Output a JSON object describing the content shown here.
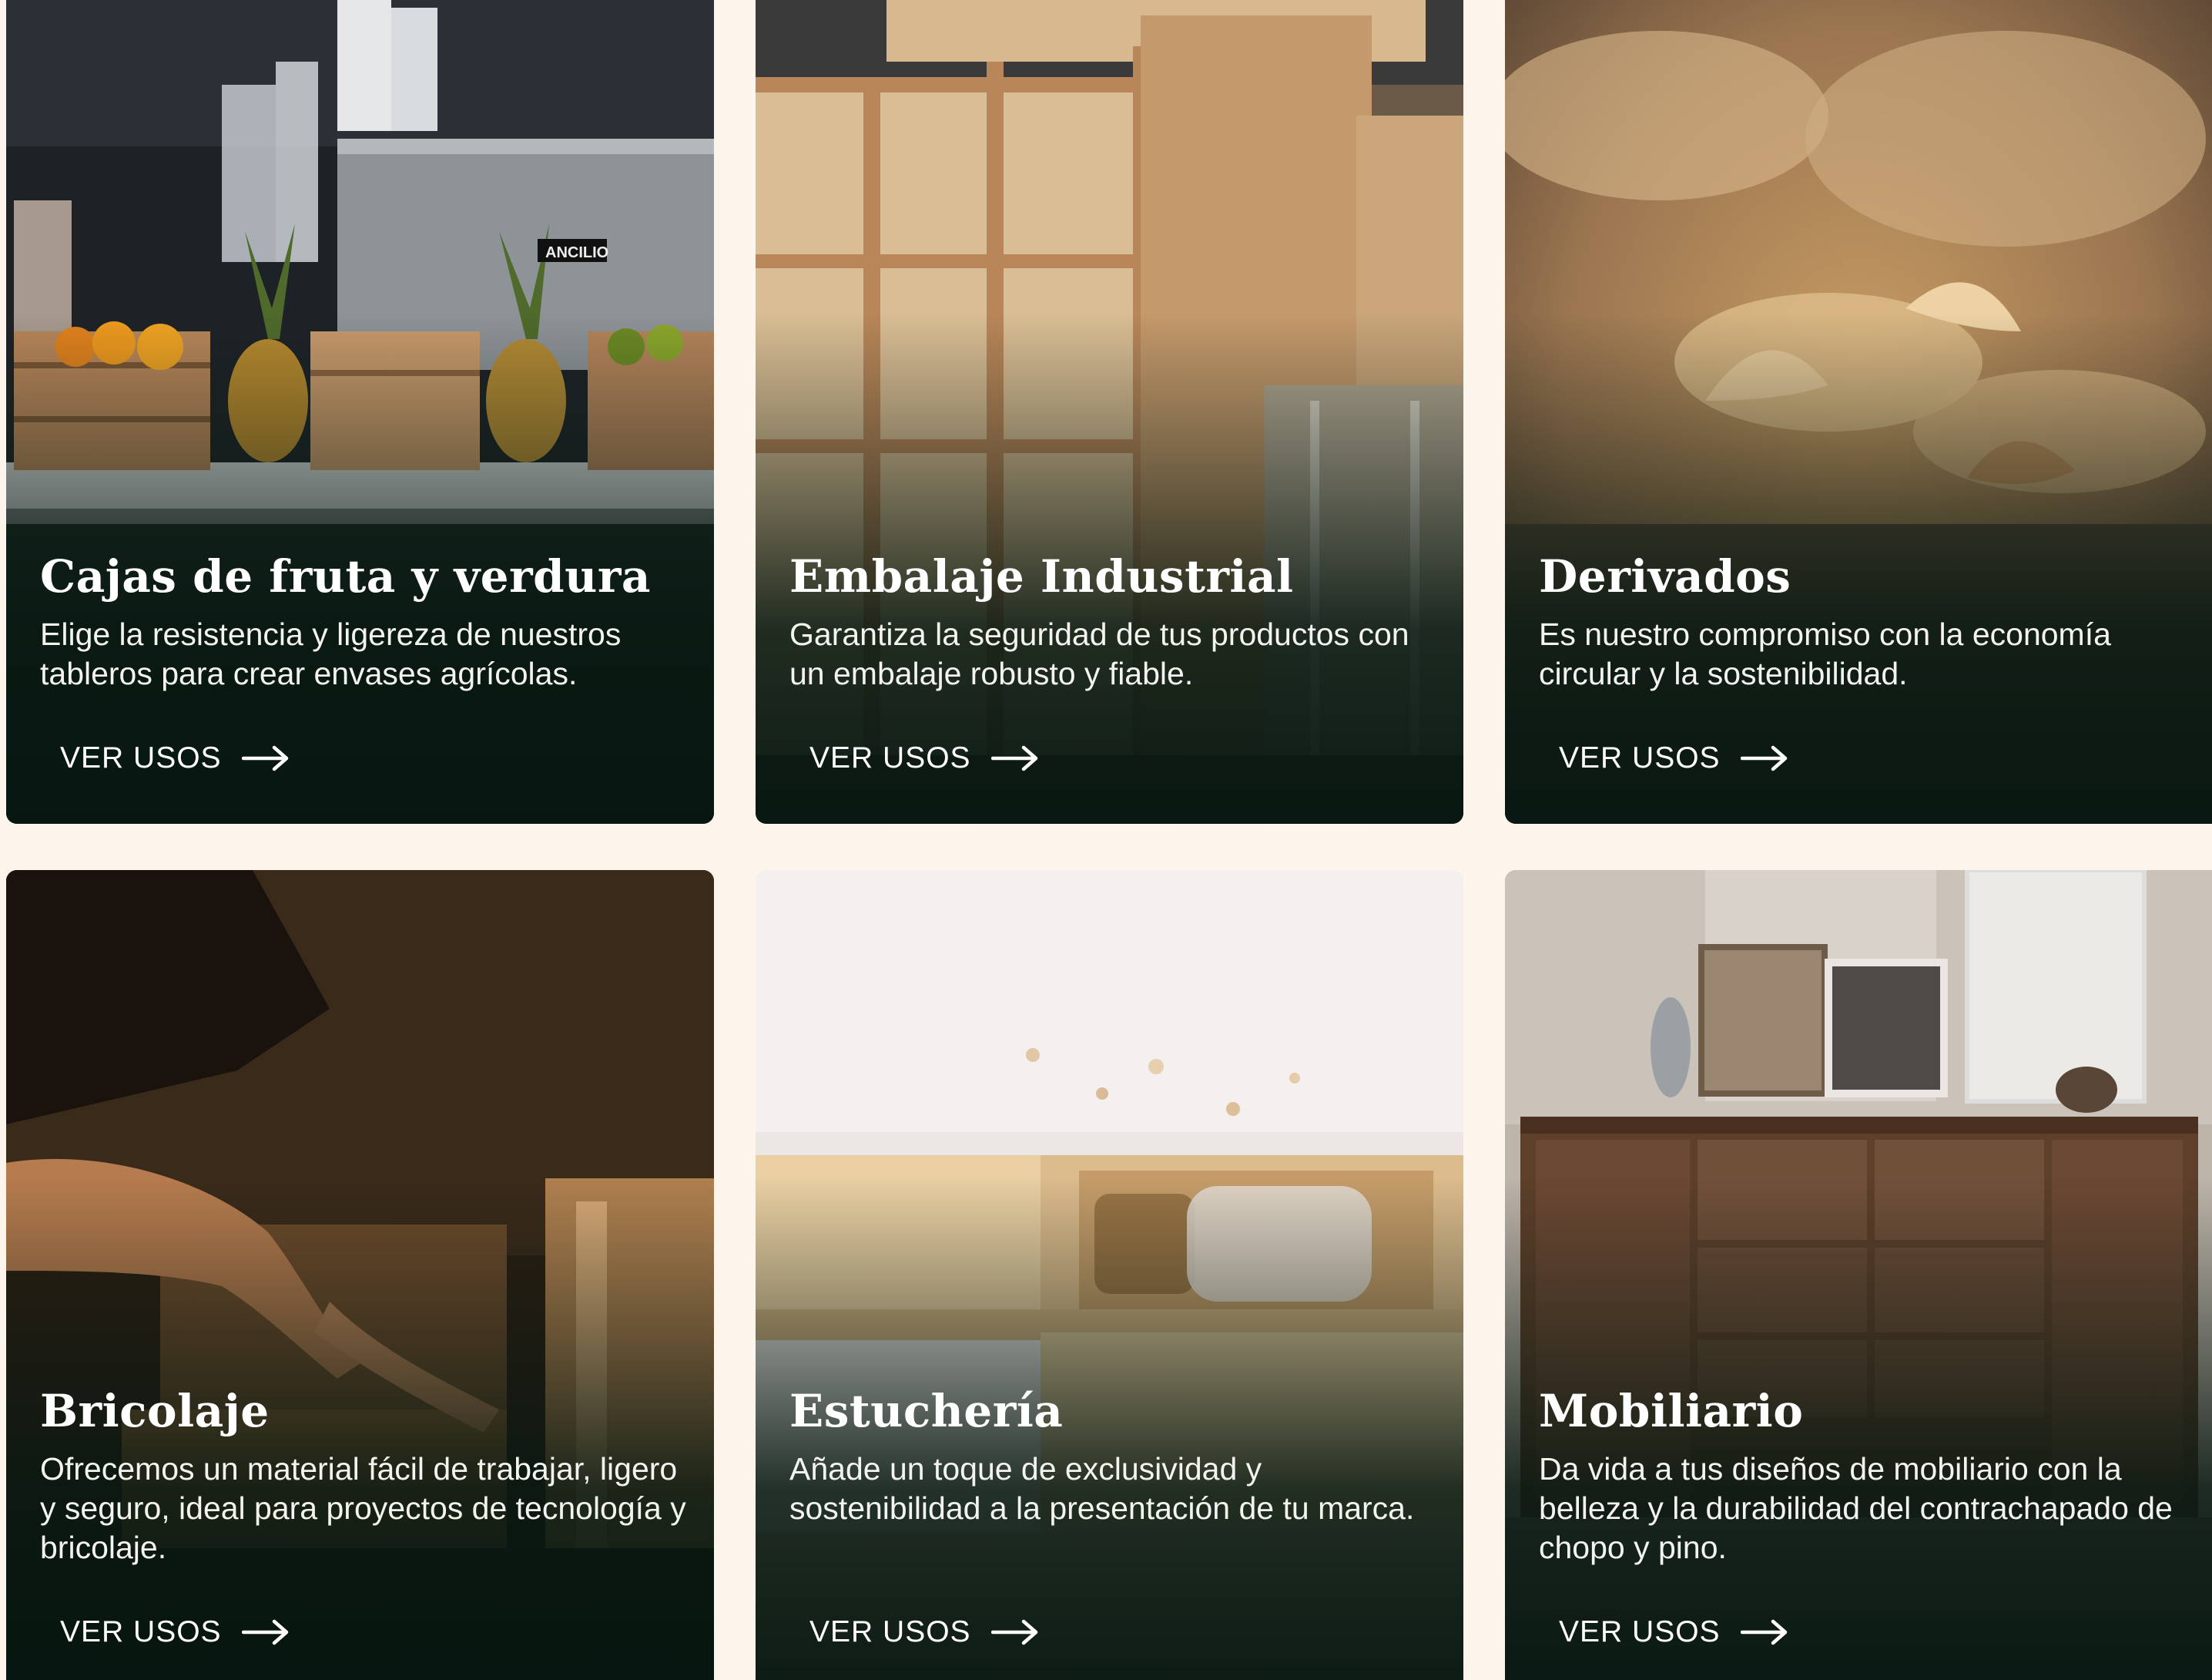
{
  "cards": [
    {
      "title": "Cajas de fruta y verdura",
      "description": "Elige la resistencia y ligereza de nuestros tableros para crear envases agrícolas.",
      "cta": "VER USOS",
      "image": "fruit-crates-photo",
      "sign_text": "ANCILIO"
    },
    {
      "title": "Embalaje Industrial",
      "description": "Garantiza la seguridad de tus productos con un embalaje robusto y fiable.",
      "cta": "VER USOS",
      "image": "industrial-crates-photo"
    },
    {
      "title": "Derivados",
      "description": "Es nuestro compromiso con la economía circular y la sostenibilidad.",
      "cta": "VER USOS",
      "image": "wood-shavings-photo"
    },
    {
      "title": "Bricolaje",
      "description": "Ofrecemos un material fácil de trabajar, ligero y seguro, ideal para proyectos de tecnología y bricolaje.",
      "cta": "VER USOS",
      "image": "woodworking-hands-photo"
    },
    {
      "title": "Estuchería",
      "description": "Añade un toque de exclusividad y sostenibilidad a la presentación de tu marca.",
      "cta": "VER USOS",
      "image": "wooden-box-photo"
    },
    {
      "title": "Mobiliario",
      "description": "Da vida a tus diseños de mobiliario con la belleza y la durabilidad del contrachapado de chopo y pino.",
      "cta": "VER USOS",
      "image": "sideboard-photo"
    }
  ],
  "colors": {
    "page_background": "#fdf4ec",
    "overlay": "#06160f",
    "text": "#ffffff"
  },
  "icons": {
    "cta": "arrow-right-icon"
  }
}
